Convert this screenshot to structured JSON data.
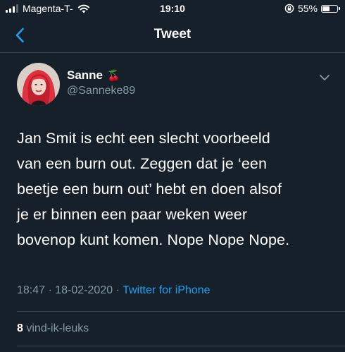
{
  "status_bar": {
    "carrier": "Magenta-T-",
    "time": "19:10",
    "battery_percent_label": "55%",
    "battery_level": 0.55
  },
  "header": {
    "title": "Tweet"
  },
  "tweet": {
    "display_name": "Sanne",
    "name_emoji": "🍒",
    "handle": "@Sanneke89",
    "text_lines": [
      "Jan Smit is echt een slecht voorbeeld",
      "van een burn out. Zeggen dat je ‘een",
      "beetje een burn out’ hebt en doen alsof",
      "je er binnen een paar weken weer",
      "bovenop kunt komen. Nope Nope Nope."
    ],
    "time": "18:47",
    "date": "18-02-2020",
    "separator": "·",
    "source": "Twitter for iPhone",
    "likes_count": "8",
    "likes_label": "vind-ik-leuks"
  },
  "colors": {
    "background": "#15202b",
    "secondary_text": "#8899a6",
    "accent": "#1da1f2",
    "divider": "#38444d"
  }
}
